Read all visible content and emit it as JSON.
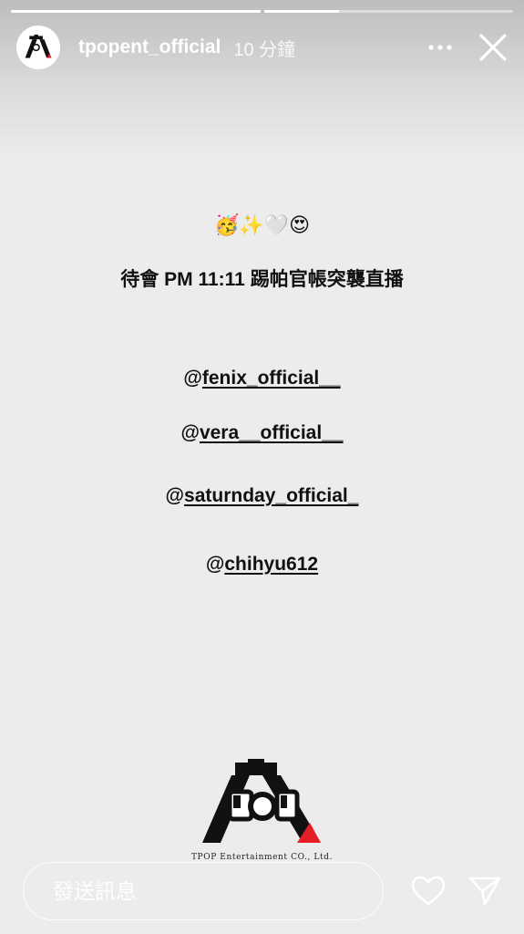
{
  "progress": [
    {
      "fraction": 1.0
    },
    {
      "fraction": 0.3
    }
  ],
  "header": {
    "username": "tpopent_official",
    "timestamp": "10 分鐘",
    "more_icon": "more-horizontal-icon",
    "close_icon": "close-icon",
    "avatar_text": "POP"
  },
  "story": {
    "emojis": "🥳✨🤍😍",
    "headline": "待會 PM 11:11 踢帕官帳突襲直播",
    "mentions": [
      {
        "at": "@",
        "handle": "fenix_official__"
      },
      {
        "at": "@",
        "handle": "vera__official__"
      },
      {
        "at": "@",
        "handle": "saturnday_official_"
      },
      {
        "at": "@",
        "handle": "chihyu612"
      }
    ],
    "logo": {
      "text": "POP",
      "caption": "TPOP Entertainment CO., Ltd.",
      "accent_color": "#e41e26"
    }
  },
  "footer": {
    "message_placeholder": "發送訊息",
    "like_icon": "heart-icon",
    "share_icon": "send-icon"
  }
}
